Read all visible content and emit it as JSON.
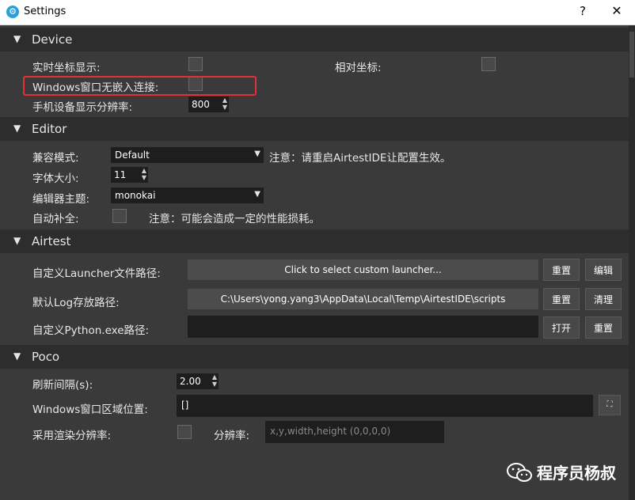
{
  "window": {
    "title": "Settings",
    "help": "?",
    "close": "✕",
    "app_icon": "⚙"
  },
  "device": {
    "header": "Device",
    "realtime_coords_label": "实时坐标显示:",
    "relative_coords_label": "相对坐标:",
    "windows_no_embed_label": "Windows窗口无嵌入连接:",
    "resolution_label": "手机设备显示分辨率:",
    "resolution_value": "800"
  },
  "editor": {
    "header": "Editor",
    "compat_label": "兼容模式:",
    "compat_value": "Default",
    "compat_note": "注意：请重启AirtestIDE让配置生效。",
    "font_size_label": "字体大小:",
    "font_size_value": "11",
    "theme_label": "编辑器主题:",
    "theme_value": "monokai",
    "autocomplete_label": "自动补全:",
    "autocomplete_note": "注意：可能会造成一定的性能损耗。"
  },
  "airtest": {
    "header": "Airtest",
    "launcher_label": "自定义Launcher文件路径:",
    "launcher_value": "Click to select custom launcher...",
    "reset": "重置",
    "edit": "编辑",
    "log_label": "默认Log存放路径:",
    "log_value": "C:\\Users\\yong.yang3\\AppData\\Local\\Temp\\AirtestIDE\\scripts",
    "clear": "清理",
    "python_label": "自定义Python.exe路径:",
    "open": "打开"
  },
  "poco": {
    "header": "Poco",
    "refresh_label": "刷新间隔(s):",
    "refresh_value": "2.00",
    "window_region_label": "Windows窗口区域位置:",
    "window_region_value": "[]",
    "render_res_label": "采用渲染分辨率:",
    "resolution_label": "分辨率:",
    "resolution_placeholder": "x,y,width,height (0,0,0,0)"
  },
  "watermark": {
    "text": "程序员杨叔"
  },
  "colors": {
    "highlight": "#e0303a",
    "section_bg": "#2d2d2d",
    "panel_bg": "#3a3a3a"
  }
}
